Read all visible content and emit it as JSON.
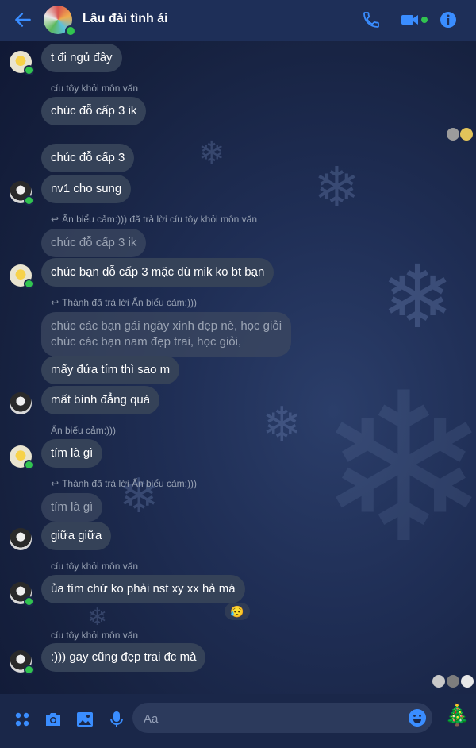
{
  "header": {
    "title": "Lâu đài tình ái"
  },
  "messages": [
    {
      "text": "t đi ngủ đây"
    },
    {
      "sender": "cíu tôy khỏi môn văn",
      "text": "chúc đỗ cấp 3 ik"
    },
    {
      "text": "chúc đỗ cấp 3"
    },
    {
      "text": "nv1 cho sung"
    },
    {
      "reply_meta": "Ẩn biểu cảm:))) đã trả lời cíu tôy khỏi môn văn",
      "quoted": "chúc đỗ cấp 3 ik",
      "text": "chúc bạn đỗ cấp 3 mặc dù mik ko bt bạn"
    },
    {
      "reply_meta": "Thành đã trả lời Ẩn biểu cảm:)))",
      "quoted_line1": "chúc các bạn gái ngày xinh đẹp nè, học giỏi",
      "quoted_line2": "chúc các bạn nam đẹp trai, học giỏi,",
      "text": "mấy đứa tím thì sao m"
    },
    {
      "text": "mất bình đẳng quá"
    },
    {
      "sender": "Ẩn biểu cảm:)))",
      "text": "tím là gì"
    },
    {
      "reply_meta": "Thành đã trả lời Ẩn biểu cảm:)))",
      "quoted": "tím là gì",
      "text": "giữa giữa"
    },
    {
      "sender": "cíu tôy khỏi môn văn",
      "text": "ủa tím chứ ko phải nst xy xx hả má",
      "reaction": "😥"
    },
    {
      "sender": "cíu tôy khỏi môn văn",
      "text": ":))) gay cũng đẹp trai đc mà"
    }
  ],
  "composer": {
    "placeholder": "Aa",
    "sticker": "🎄"
  },
  "colors": {
    "accent": "#3a8dff",
    "bubble": "#354258",
    "online": "#31c450",
    "header": "#1e2f58"
  },
  "icons": [
    "back-arrow-icon",
    "phone-icon",
    "video-camera-icon",
    "info-icon",
    "apps-icon",
    "camera-icon",
    "image-icon",
    "microphone-icon",
    "emoji-icon"
  ]
}
